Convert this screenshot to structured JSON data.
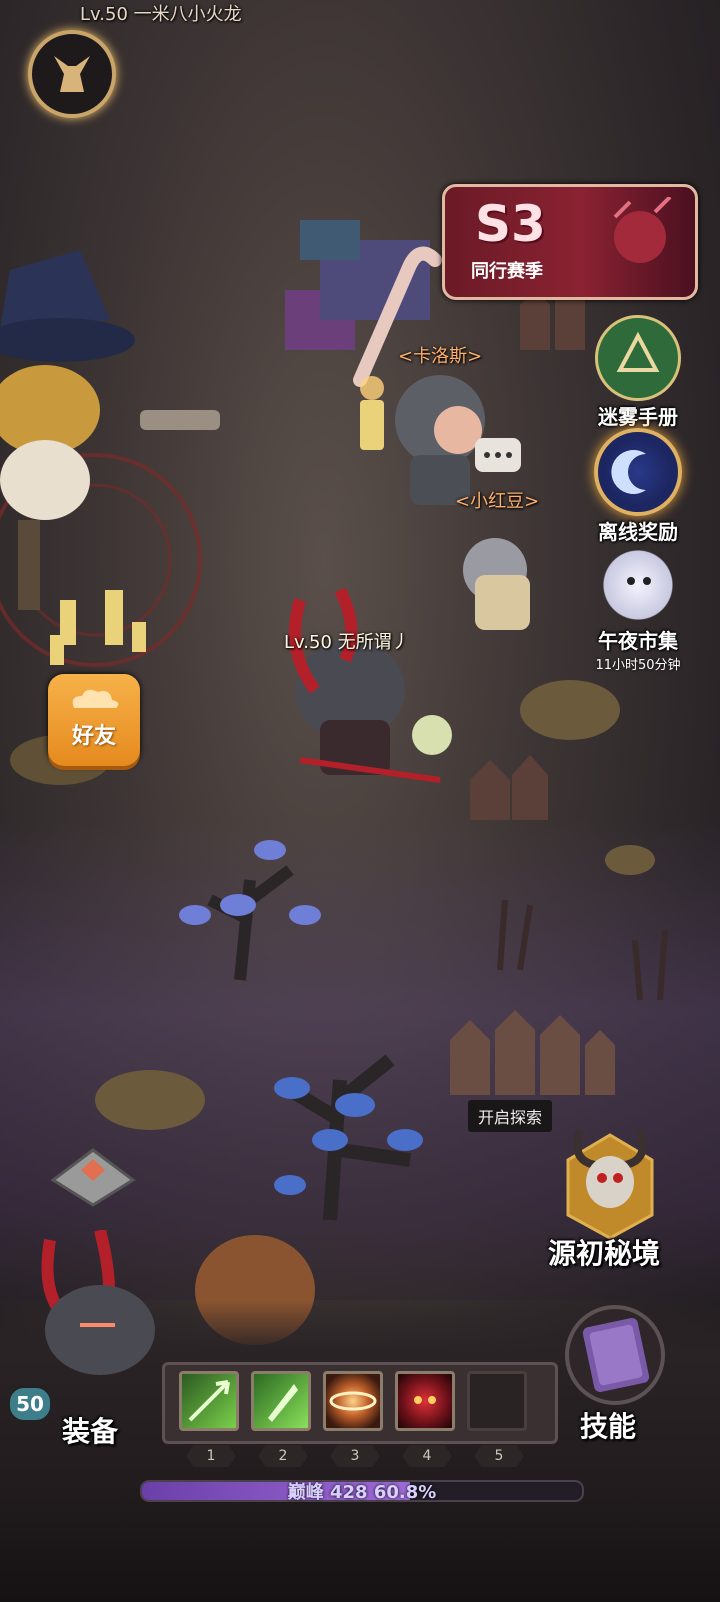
{
  "top_player": {
    "label": "Lv.50 一米八小火龙"
  },
  "season": {
    "code": "S3",
    "name": "同行赛季"
  },
  "side_menu": [
    {
      "label": "迷雾手册",
      "sub": ""
    },
    {
      "label": "离线奖励",
      "sub": ""
    },
    {
      "label": "午夜市集",
      "sub": "11小时50分钟"
    }
  ],
  "npcs": [
    {
      "name": "<卡洛斯>"
    },
    {
      "name": "<小红豆>"
    }
  ],
  "player": {
    "label": "Lv.50 无所谓丿"
  },
  "friends_button": {
    "label": "好友"
  },
  "explore": {
    "tooltip": "开启探索",
    "label": "源初秘境"
  },
  "hero": {
    "level": "50",
    "equip_label": "装备"
  },
  "skills": {
    "label": "技能",
    "slots": [
      {
        "num": "1",
        "icon": "green-arrow-icon"
      },
      {
        "num": "2",
        "icon": "green-shard-icon"
      },
      {
        "num": "3",
        "icon": "vortex-icon"
      },
      {
        "num": "4",
        "icon": "demon-face-icon"
      },
      {
        "num": "5",
        "icon": ""
      }
    ]
  },
  "progress": {
    "label": "巅峰 428 ",
    "percent_text": "60.8%",
    "fraction": 0.608
  },
  "colors": {
    "accent_orange": "#ffb06a",
    "xp_purple": "#9e6bd6",
    "season_red": "#8a2232"
  }
}
